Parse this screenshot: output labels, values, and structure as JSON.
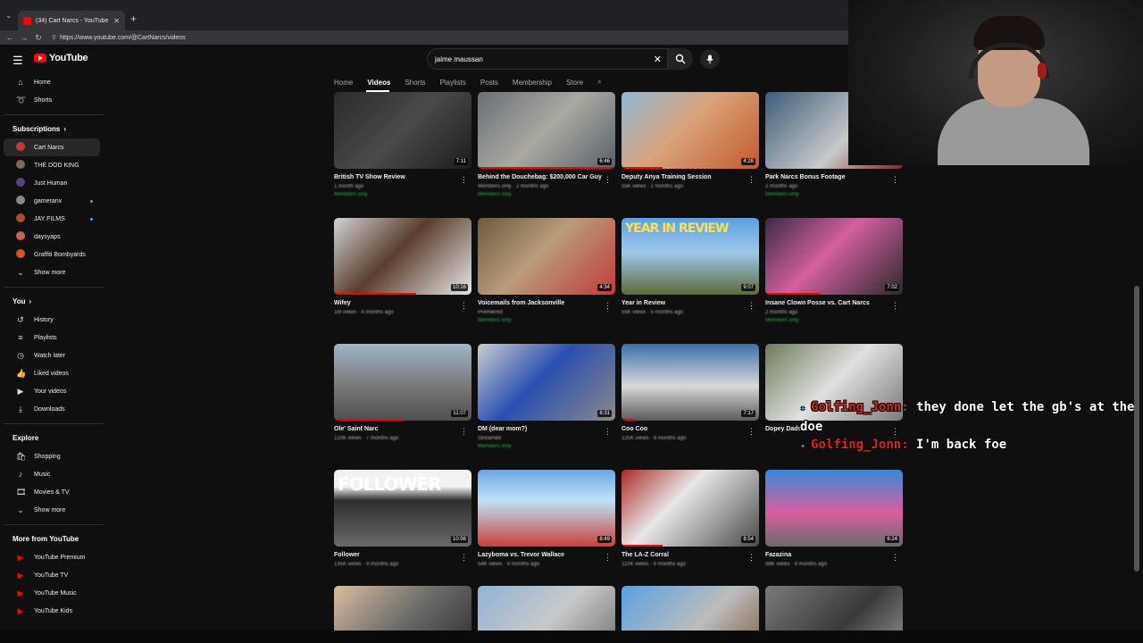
{
  "browser": {
    "tab_title": "(34) Cart Narcs - YouTube",
    "tab_close": "✕",
    "new_tab": "+",
    "url": "https://www.youtube.com/@CartNarcs/videos"
  },
  "header": {
    "logo_text": "YouTube",
    "search_value": "jaime maussan",
    "search_clear": "✕"
  },
  "sidebar": {
    "main": [
      {
        "label": "Home",
        "icon": "home-icon"
      },
      {
        "label": "Shorts",
        "icon": "shorts-icon"
      }
    ],
    "subscriptions_heading": "Subscriptions",
    "subscriptions": [
      {
        "label": "Cart Narcs",
        "color": "#c23b3b",
        "active": true,
        "live": false
      },
      {
        "label": "THE DOD KING",
        "color": "#7b6a5a",
        "live": false
      },
      {
        "label": "Just Human",
        "color": "#5a3d8a",
        "live": false
      },
      {
        "label": "gameranx",
        "color": "#888888",
        "live": true
      },
      {
        "label": "JAY FILMS",
        "color": "#b04a2e",
        "live": true
      },
      {
        "label": "daysyaps",
        "color": "#c7634b",
        "live": false
      },
      {
        "label": "Graffiti Bombyards",
        "color": "#d4542a",
        "live": false
      }
    ],
    "show_more_1": "Show more",
    "you_heading": "You",
    "you_items": [
      {
        "label": "History",
        "icon": "history-icon"
      },
      {
        "label": "Playlists",
        "icon": "playlists-icon"
      },
      {
        "label": "Watch later",
        "icon": "watch-later-icon"
      },
      {
        "label": "Liked videos",
        "icon": "liked-videos-icon"
      },
      {
        "label": "Your videos",
        "icon": "your-videos-icon"
      },
      {
        "label": "Downloads",
        "icon": "downloads-icon"
      }
    ],
    "explore_heading": "Explore",
    "explore_items": [
      {
        "label": "Shopping",
        "icon": "shopping-icon"
      },
      {
        "label": "Music",
        "icon": "music-icon"
      },
      {
        "label": "Movies & TV",
        "icon": "movies-icon"
      }
    ],
    "show_more_2": "Show more",
    "more_heading": "More from YouTube",
    "more_items": [
      {
        "label": "YouTube Premium"
      },
      {
        "label": "YouTube TV"
      },
      {
        "label": "YouTube Music"
      },
      {
        "label": "YouTube Kids"
      }
    ]
  },
  "channel_tabs": [
    "Home",
    "Videos",
    "Shorts",
    "Playlists",
    "Posts",
    "Membership",
    "Store"
  ],
  "videos": [
    [
      {
        "title": "British TV Show Review",
        "duration": "7:11",
        "meta": "1 month ago",
        "badge": "Members only",
        "progress": 0,
        "bg": "linear-gradient(135deg,#2b2b2b,#4a4a4a 50%,#1c1c1c)"
      },
      {
        "title": "Behind the Douchebag: $200,000 Car Guy",
        "duration": "6:46",
        "meta": "Members only · 2 months ago",
        "badge": "Members only",
        "progress": 1,
        "bg": "linear-gradient(135deg,#6a6f78,#a9a9a0 50%,#59606a)"
      },
      {
        "title": "Deputy Anya Training Session",
        "duration": "4:28",
        "meta": "55K views · 2 months ago",
        "badge": "",
        "progress": 0.3,
        "bg": "linear-gradient(135deg,#8fb7d6,#d9a37a 45%,#c45a2a)"
      },
      {
        "title": "Park Narcs Bonus Footage",
        "duration": "",
        "meta": "2 months ago",
        "badge": "Members only",
        "progress": 0,
        "bg": "linear-gradient(135deg,#3d5c7a,#c9c9c9 60%,#8a1f1f)"
      }
    ],
    [
      {
        "title": "Wifey",
        "duration": "10:16",
        "meta": "1M views · 4 months ago",
        "badge": "",
        "progress": 0.6,
        "bg": "linear-gradient(135deg,#cfd3d6,#5a3d2b 45%,#e7e7e7)"
      },
      {
        "title": "Voicemails from Jacksonville",
        "duration": "4:34",
        "meta": "Premiered",
        "badge": "Members only",
        "progress": 0,
        "bg": "linear-gradient(135deg,#6b5b3e,#b99b7a 45%,#c23b3b)"
      },
      {
        "title": "Year in Review",
        "duration": "9:07",
        "meta": "55K views · 5 months ago",
        "badge": "",
        "progress": 0,
        "bg": "linear-gradient(180deg,#5aa0e0,#9fc7e8 45%,#5e6a3a)"
      },
      {
        "title": "Insane Clown Posse vs. Cart Narcs",
        "duration": "7:02",
        "meta": "2 months ago",
        "badge": "Members only",
        "progress": 0.4,
        "bg": "linear-gradient(135deg,#3a2b44,#d45fa0 45%,#2a2a2a)"
      }
    ],
    [
      {
        "title": "Ole' Saint Narc",
        "duration": "11:07",
        "meta": "120K views · 7 months ago",
        "badge": "",
        "progress": 0.5,
        "bg": "linear-gradient(180deg,#9fb6cc,#7d7d7d 50%,#4f4f4f)"
      },
      {
        "title": "DM (dear mom?)",
        "duration": "8:31",
        "meta": "Streamed",
        "badge": "Members only",
        "progress": 0,
        "bg": "linear-gradient(135deg,#c9cdd1,#2a4fb0 45%,#8a8a8a)"
      },
      {
        "title": "Coo Coo",
        "duration": "7:17",
        "meta": "125K views · 8 months ago",
        "badge": "",
        "progress": 0.1,
        "bg": "linear-gradient(180deg,#3b6fa8,#d8d8d8 55%,#5b5b5b)"
      },
      {
        "title": "Dopey Dads",
        "duration": "",
        "meta": "",
        "badge": "",
        "progress": 0,
        "bg": "linear-gradient(135deg,#6d7a5a,#e0e0e0 50%,#7a7a7a)"
      }
    ],
    [
      {
        "title": "Follower",
        "duration": "10:56",
        "meta": "135K views · 9 months ago",
        "badge": "",
        "progress": 0,
        "bg": "linear-gradient(180deg,#f2f2f2,#f2f2f2 22%,#2e2e2e 40%,#6a6a6a)"
      },
      {
        "title": "Lazyboma vs. Trevor Wallace",
        "duration": "8:49",
        "meta": "54K views · 9 months ago",
        "badge": "",
        "progress": 0,
        "bg": "linear-gradient(180deg,#6ba6e0,#bfe1f7 40%,#c9403a)"
      },
      {
        "title": "The LA-Z Corral",
        "duration": "8:54",
        "meta": "110K views · 9 months ago",
        "badge": "",
        "progress": 0.3,
        "bg": "linear-gradient(135deg,#ad2a2a,#e7e7e7 40%,#4a4a4a)"
      },
      {
        "title": "Fazazina",
        "duration": "6:24",
        "meta": "98K views · 9 months ago",
        "badge": "",
        "progress": 0,
        "bg": "linear-gradient(180deg,#3a88d8,#d85fa0 55%,#6b6b6b)"
      }
    ],
    [
      {
        "title": "",
        "duration": "",
        "meta": "",
        "badge": "",
        "progress": 0,
        "bg": "linear-gradient(135deg,#d8bca0,#6a6a6a 50%,#2a2a2a)"
      },
      {
        "title": "",
        "duration": "",
        "meta": "",
        "badge": "",
        "progress": 0,
        "bg": "linear-gradient(135deg,#8fb2d6,#c9c9c9 50%,#6a6a6a)"
      },
      {
        "title": "",
        "duration": "",
        "meta": "",
        "badge": "",
        "progress": 0,
        "bg": "linear-gradient(135deg,#5aa0e0,#bdbdbd 55%,#7a5a3a)"
      },
      {
        "title": "",
        "duration": "",
        "meta": "",
        "badge": "",
        "progress": 0,
        "bg": "linear-gradient(135deg,#7a7a7a,#3a3a3a 55%,#9a9a9a)"
      }
    ]
  ],
  "thumb_text": {
    "follower": "FOLLOWER",
    "year_in_review": "YEAR IN REVIEW"
  },
  "chat": [
    {
      "user": "Golfing_Jonn:",
      "message": "they done let the gb's at the doe"
    },
    {
      "user": "Golfing_Jonn:",
      "message": "I'm back foe"
    }
  ]
}
